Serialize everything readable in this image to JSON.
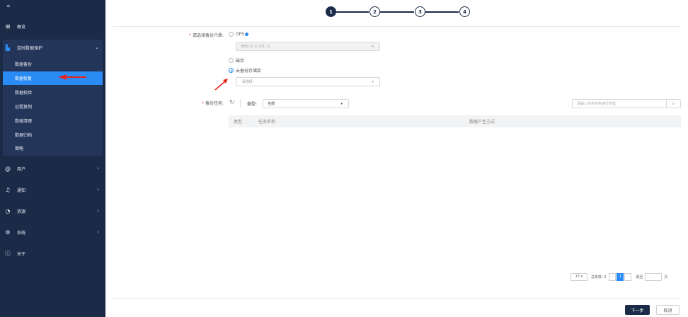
{
  "sidebar": {
    "collapse": "«",
    "overview": "概览",
    "group": "定时数据保护",
    "sub_items": [
      "数据备份",
      "数据恢复",
      "数据校验",
      "远程复制",
      "数据清理",
      "数据归档",
      "策略"
    ],
    "users": "用户",
    "notify": "通知",
    "resources": "资源",
    "system": "系统",
    "about": "关于"
  },
  "steps": [
    "1",
    "2",
    "3",
    "4"
  ],
  "form": {
    "media_label": "备份介质:",
    "media_label_full": "请选择备份介质:",
    "opt_ofs": "OFS",
    "ofs_value": "津南(10.4.131.11",
    "opt_tape": "磁带",
    "opt_cloud": "云备份存储库",
    "cloud_placeholder": "-请选择-",
    "task_label": "备份任务:",
    "type_label": "类型:",
    "type_value": "全部",
    "search_placeholder": "请输入任务名称进行查找"
  },
  "table": {
    "columns": [
      "类型",
      "任务名称",
      "数据产生方式"
    ]
  },
  "pager": {
    "page_size": "15",
    "total": "总条数: 0",
    "current": "1",
    "goto": "跳至",
    "page_unit": "页"
  },
  "buttons": {
    "next": "下一步",
    "cancel": "取消"
  },
  "colors": {
    "sidebar_bg": "#1b2a47",
    "active": "#2b8bf5",
    "annotation": "#e8231c"
  }
}
